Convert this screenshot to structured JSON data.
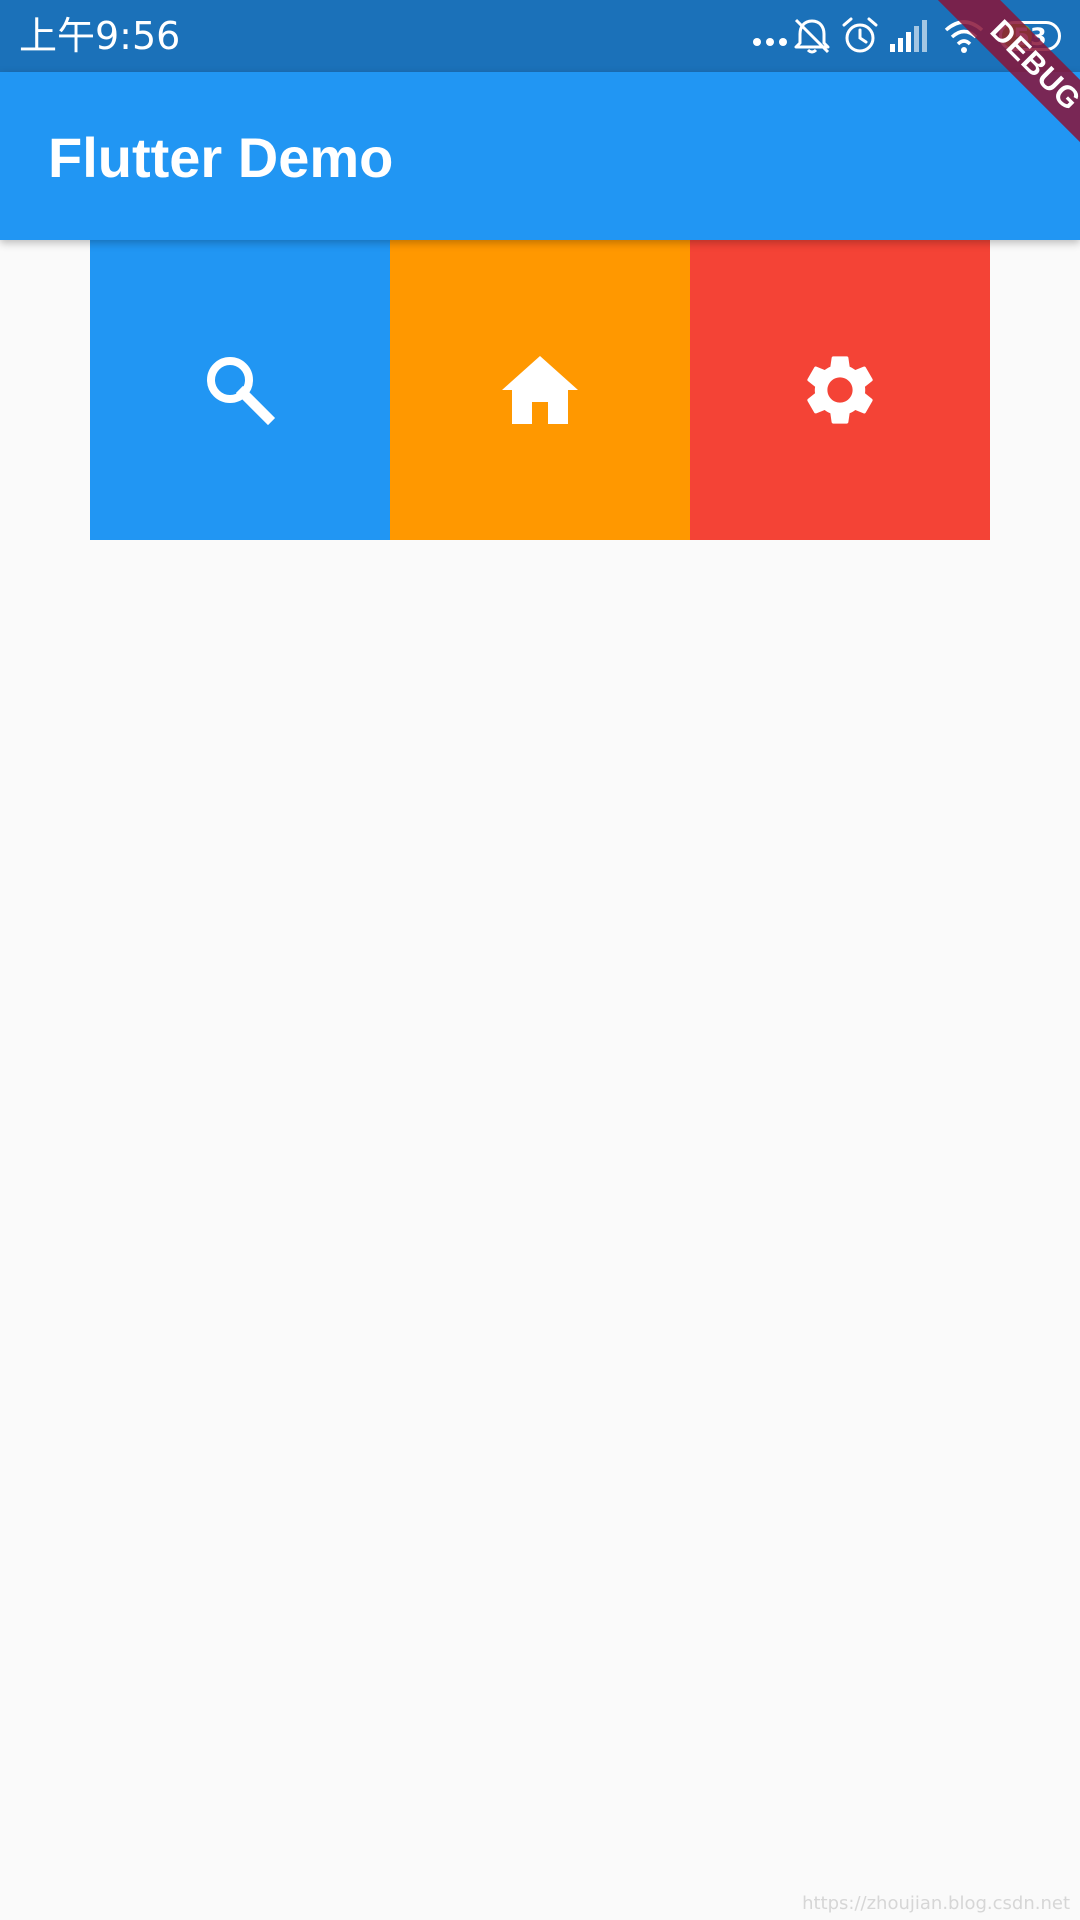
{
  "status_bar": {
    "time": "上午9:56",
    "icons": [
      "more-dots-icon",
      "notifications-off-icon",
      "alarm-icon",
      "signal-icon",
      "wifi-icon"
    ],
    "battery": {
      "label": "53",
      "level": 0.53,
      "fill_color": "#7ed321"
    },
    "background": "#1b71b9"
  },
  "app_bar": {
    "title": "Flutter Demo",
    "background": "#2196f3"
  },
  "tiles": [
    {
      "icon": "search-icon",
      "color": "#2196f3"
    },
    {
      "icon": "home-icon",
      "color": "#ff9800"
    },
    {
      "icon": "settings-icon",
      "color": "#f44336"
    }
  ],
  "debug_banner": {
    "label": "DEBUG"
  },
  "watermark": "https://zhoujian.blog.csdn.net"
}
